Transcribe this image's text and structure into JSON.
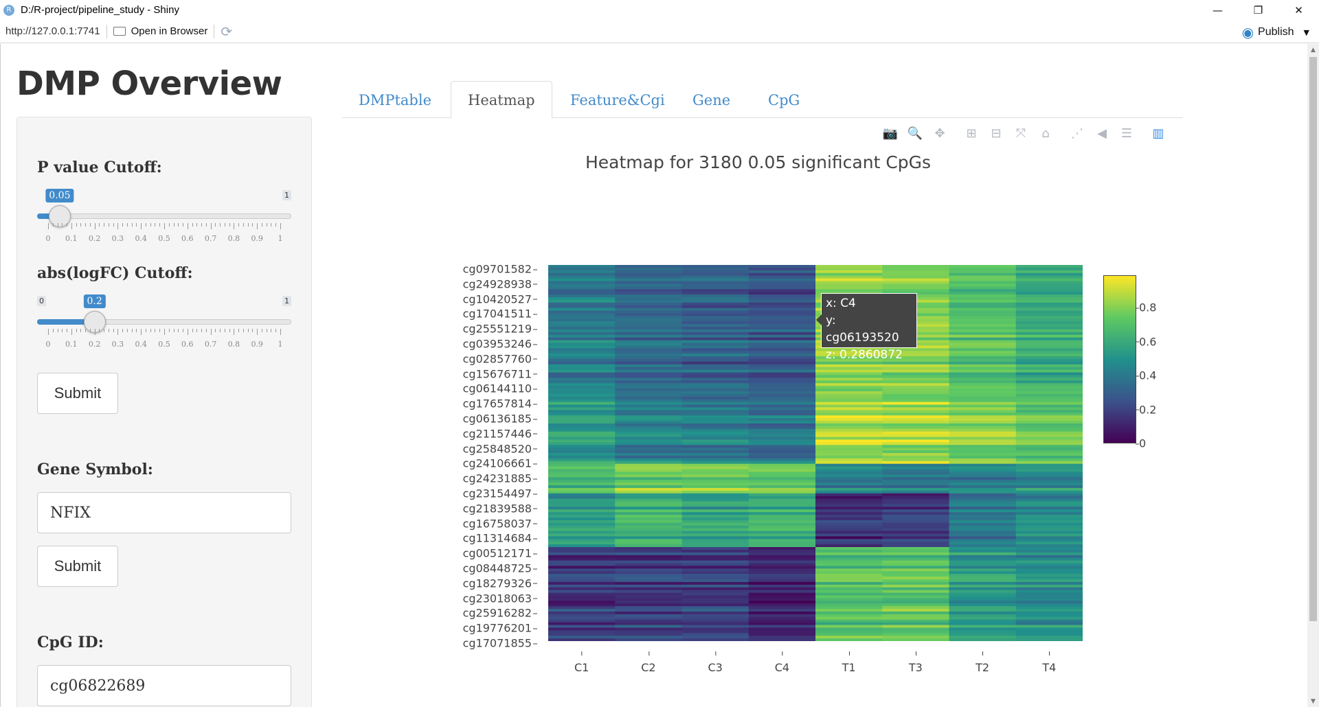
{
  "window": {
    "title": "D:/R-project/pipeline_study - Shiny",
    "app_icon": "R",
    "minimize": "—",
    "restore": "❐",
    "close": "✕"
  },
  "addressbar": {
    "url": "http://127.0.0.1:7741",
    "open_in_browser": "Open in Browser",
    "refresh_icon": "⟳",
    "publish": "Publish"
  },
  "page": {
    "title": "DMP Overview"
  },
  "sidebar": {
    "pvalue": {
      "label": "P value Cutoff:",
      "min": "0",
      "max": "1",
      "value": "0.05",
      "value_num": 0.05,
      "ticks": [
        "0",
        "0.1",
        "0.2",
        "0.3",
        "0.4",
        "0.5",
        "0.6",
        "0.7",
        "0.8",
        "0.9",
        "1"
      ]
    },
    "logfc": {
      "label": "abs(logFC) Cutoff:",
      "min": "0",
      "max": "1",
      "value": "0.2",
      "value_num": 0.2,
      "ticks": [
        "0",
        "0.1",
        "0.2",
        "0.3",
        "0.4",
        "0.5",
        "0.6",
        "0.7",
        "0.8",
        "0.9",
        "1"
      ]
    },
    "submit1": "Submit",
    "gene": {
      "label": "Gene Symbol:",
      "value": "NFIX"
    },
    "submit2": "Submit",
    "cpg": {
      "label": "CpG ID:",
      "value": "cg06822689"
    }
  },
  "tabs": [
    {
      "label": "DMPtable",
      "active": false
    },
    {
      "label": "Heatmap",
      "active": true
    },
    {
      "label": "Feature&Cgi",
      "active": false
    },
    {
      "label": "Gene",
      "active": false
    },
    {
      "label": "CpG",
      "active": false
    }
  ],
  "modebar": [
    {
      "icon": "camera-icon",
      "glyph": "📷"
    },
    {
      "icon": "zoom-icon",
      "glyph": "🔍"
    },
    {
      "icon": "pan-icon",
      "glyph": "✥"
    },
    {
      "icon": "zoom-in-icon",
      "glyph": "⊞"
    },
    {
      "icon": "zoom-out-icon",
      "glyph": "⊟"
    },
    {
      "icon": "autoscale-icon",
      "glyph": "⤧"
    },
    {
      "icon": "home-icon",
      "glyph": "⌂"
    },
    {
      "icon": "spike-lines-icon",
      "glyph": "⋰"
    },
    {
      "icon": "hover-closest-icon",
      "glyph": "◀"
    },
    {
      "icon": "hover-compare-icon",
      "glyph": "☰"
    },
    {
      "icon": "plotly-logo-icon",
      "glyph": "▥"
    }
  ],
  "tooltip": {
    "x": "x: C4",
    "y": "y: cg06193520",
    "z": "z: 0.2860872"
  },
  "chart_data": {
    "type": "heatmap",
    "title": "Heatmap for 3180 0.05 significant CpGs",
    "x": [
      "C1",
      "C2",
      "C3",
      "C4",
      "T1",
      "T3",
      "T2",
      "T4"
    ],
    "y_tick_labels": [
      "cg09701582",
      "cg24928938",
      "cg10420527",
      "cg17041511",
      "cg25551219",
      "cg03953246",
      "cg02857760",
      "cg15676711",
      "cg06144110",
      "cg17657814",
      "cg06136185",
      "cg21157446",
      "cg25848520",
      "cg24106661",
      "cg24231885",
      "cg23154497",
      "cg21839588",
      "cg16758037",
      "cg11314684",
      "cg00512171",
      "cg08448725",
      "cg18279326",
      "cg23018063",
      "cg25916282",
      "cg19776201",
      "cg17071855"
    ],
    "colorscale": "viridis",
    "zlim": [
      0,
      1
    ],
    "colorbar_ticks": [
      "0",
      "0.2",
      "0.4",
      "0.6",
      "0.8"
    ],
    "blocks": [
      {
        "rows_fraction": [
          0,
          0.32
        ],
        "values": [
          0.42,
          0.35,
          0.32,
          0.28,
          0.85,
          0.82,
          0.72,
          0.62
        ]
      },
      {
        "rows_fraction": [
          0.32,
          0.53
        ],
        "values": [
          0.55,
          0.45,
          0.42,
          0.38,
          0.88,
          0.86,
          0.82,
          0.75
        ]
      },
      {
        "rows_fraction": [
          0.53,
          0.61
        ],
        "values": [
          0.68,
          0.78,
          0.78,
          0.78,
          0.45,
          0.42,
          0.45,
          0.5
        ]
      },
      {
        "rows_fraction": [
          0.61,
          0.75
        ],
        "values": [
          0.5,
          0.6,
          0.55,
          0.6,
          0.12,
          0.15,
          0.35,
          0.45
        ]
      },
      {
        "rows_fraction": [
          0.75,
          1.0
        ],
        "values": [
          0.18,
          0.2,
          0.2,
          0.12,
          0.72,
          0.74,
          0.55,
          0.5
        ]
      }
    ]
  }
}
